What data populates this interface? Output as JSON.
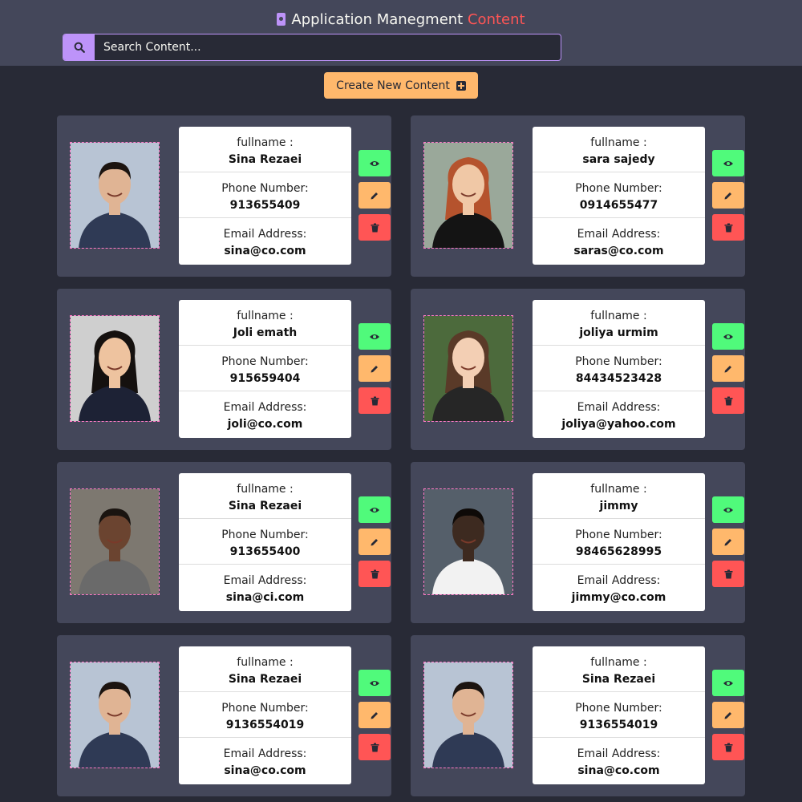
{
  "header": {
    "title_main": "Application Manegment",
    "title_accent": "Content",
    "title_icon": "contact-card-icon",
    "search_placeholder": "Search Content...",
    "search_icon": "search-icon"
  },
  "create_button": {
    "label": "Create New Content",
    "icon": "plus-square-icon"
  },
  "labels": {
    "fullname": "fullname :",
    "phone": "Phone Number:",
    "email": "Email Address:"
  },
  "contacts": [
    {
      "fullname": "Sina Rezaei",
      "phone": "913655409",
      "email": "sina@co.com"
    },
    {
      "fullname": "sara sajedy",
      "phone": "0914655477",
      "email": "saras@co.com"
    },
    {
      "fullname": "Joli emath",
      "phone": "915659404",
      "email": "joli@co.com"
    },
    {
      "fullname": "joliya urmim",
      "phone": "84434523428",
      "email": "joliya@yahoo.com"
    },
    {
      "fullname": "Sina Rezaei",
      "phone": "913655400",
      "email": "sina@ci.com"
    },
    {
      "fullname": "jimmy",
      "phone": "98465628995",
      "email": "jimmy@co.com"
    },
    {
      "fullname": "Sina Rezaei",
      "phone": "9136554019",
      "email": "sina@co.com"
    },
    {
      "fullname": "Sina Rezaei",
      "phone": "9136554019",
      "email": "sina@co.com"
    }
  ],
  "colors": {
    "background": "#282a36",
    "panel": "#44475a",
    "purple": "#bd93f9",
    "accent_red": "#ff5555",
    "view": "#50fa7b",
    "edit": "#ffb86c",
    "delete": "#ff5555"
  },
  "action_icons": {
    "view": "eye-icon",
    "edit": "pencil-icon",
    "delete": "trash-icon"
  }
}
